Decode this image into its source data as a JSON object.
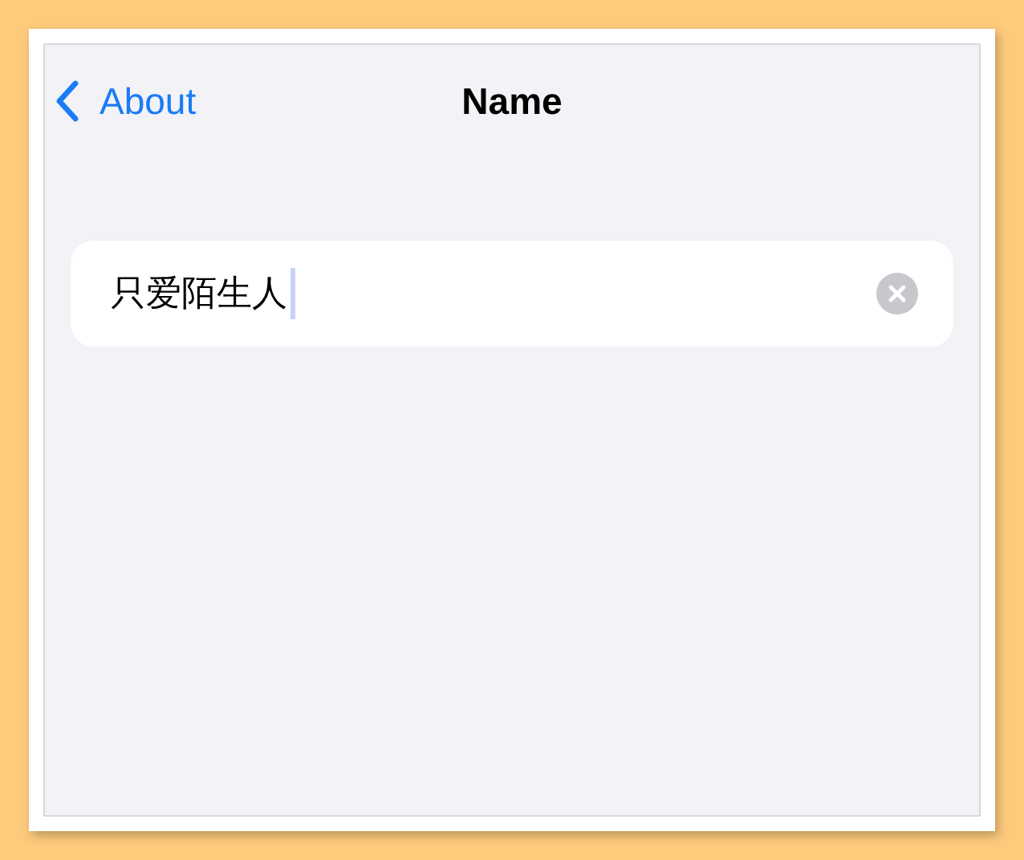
{
  "nav_bar": {
    "back_label": "About",
    "title": "Name"
  },
  "name_field": {
    "value": "只爱陌生人",
    "focused": true
  }
}
